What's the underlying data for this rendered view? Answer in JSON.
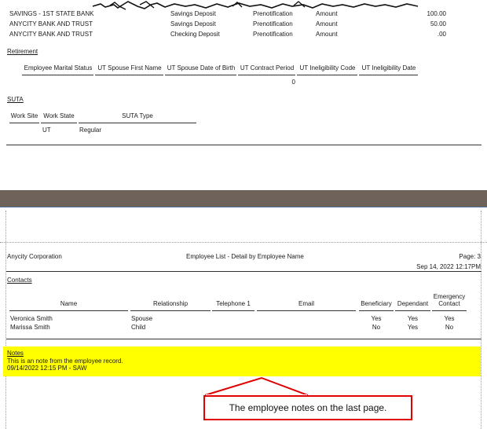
{
  "deposits": [
    {
      "bank": "SAVINGS - 1ST STATE BANK",
      "account": "Savings Deposit",
      "status": "Prenotification",
      "calc": "Amount",
      "amount": "100.00"
    },
    {
      "bank": "ANYCITY BANK AND TRUST",
      "account": "Savings Deposit",
      "status": "Prenotification",
      "calc": "Amount",
      "amount": "50.00"
    },
    {
      "bank": "ANYCITY BANK AND TRUST",
      "account": "Checking Deposit",
      "status": "Prenotification",
      "calc": "Amount",
      "amount": ".00"
    }
  ],
  "retirement": {
    "title": "Retirement",
    "headers": [
      "Employee Marital Status",
      "UT Spouse First Name",
      "UT Spouse Date of Birth",
      "UT Contract Period",
      "UT Ineligibility Code",
      "UT Ineligibility Date"
    ],
    "row": {
      "contract_period": "0"
    }
  },
  "suta": {
    "title": "SUTA",
    "headers": [
      "Work Site",
      "Work State",
      "SUTA Type"
    ],
    "row": {
      "work_site": "",
      "work_state": "UT",
      "suta_type": "Regular"
    }
  },
  "page_header": {
    "company": "Anycity Corporation",
    "report_title": "Employee List - Detail by Employee Name",
    "page": "Page: 3",
    "datetime": "Sep 14, 2022 12:17PM"
  },
  "contacts": {
    "title": "Contacts",
    "headers": {
      "name": "Name",
      "relationship": "Relationship",
      "telephone": "Telephone 1",
      "email": "Email",
      "beneficiary": "Beneficiary",
      "dependant": "Dependant",
      "emergency1": "Emergency",
      "emergency2": "Contact"
    },
    "rows": [
      {
        "name": "Veronica Smith",
        "relationship": "Spouse",
        "beneficiary": "Yes",
        "dependant": "Yes",
        "emergency": "Yes"
      },
      {
        "name": "Marissa Smith",
        "relationship": "Child",
        "beneficiary": "No",
        "dependant": "Yes",
        "emergency": "No"
      }
    ]
  },
  "notes": {
    "title": "Notes",
    "text": "This is an note from the employee record.",
    "stamp": "09/14/2022 12:15 PM - SAW"
  },
  "callout": {
    "text": "The employee notes on the last page."
  },
  "colors": {
    "highlight": "#ffff00",
    "callout_border": "#e00000",
    "divider": "#6e625b"
  }
}
